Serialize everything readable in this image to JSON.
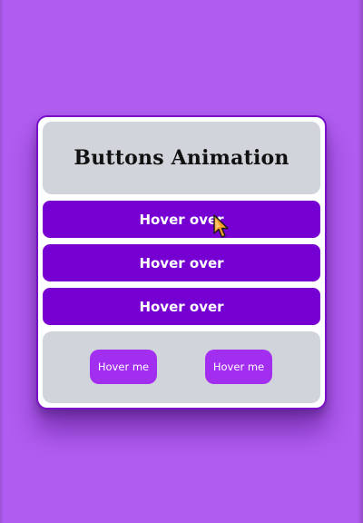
{
  "card": {
    "title": "Buttons Animation",
    "wide_buttons": [
      {
        "label": "Hover over"
      },
      {
        "label": "Hover over"
      },
      {
        "label": "Hover over"
      }
    ],
    "small_buttons": [
      {
        "label": "Hover me"
      },
      {
        "label": "Hover me"
      }
    ]
  },
  "icons": {
    "cursor": "pointer-cursor-icon"
  },
  "colors": {
    "background": "#b05cf0",
    "card_border": "#7a0fc9",
    "panel": "#d1d5db",
    "wide_button": "#7600d1",
    "small_button": "#a22ef0",
    "cursor": "#f59e2b"
  }
}
